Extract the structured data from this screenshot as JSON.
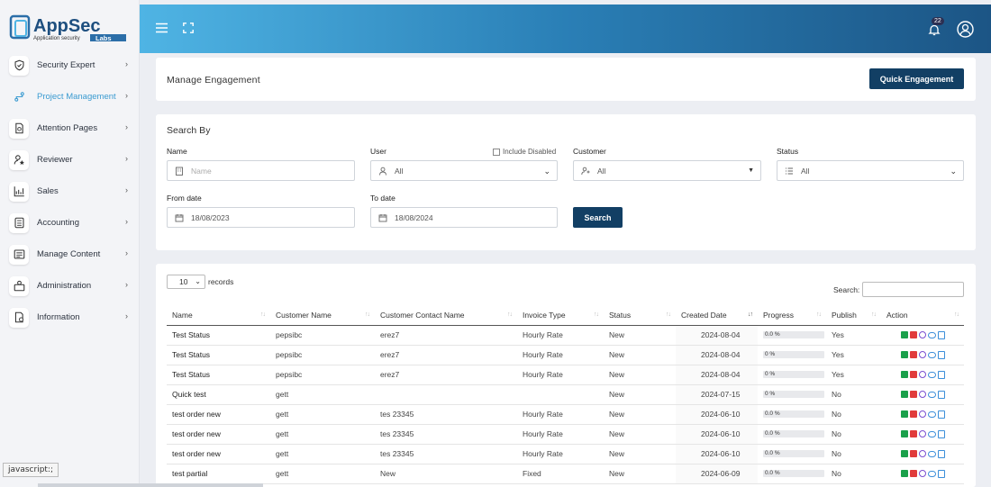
{
  "brand": {
    "name": "AppSec",
    "tagline": "Application security",
    "suffix": "Labs"
  },
  "sidebar": {
    "items": [
      {
        "label": "Security Expert",
        "icon": "shield-icon"
      },
      {
        "label": "Project Management",
        "icon": "project-icon"
      },
      {
        "label": "Attention Pages",
        "icon": "file-icon"
      },
      {
        "label": "Reviewer",
        "icon": "user-star-icon"
      },
      {
        "label": "Sales",
        "icon": "chart-icon"
      },
      {
        "label": "Accounting",
        "icon": "calculator-icon"
      },
      {
        "label": "Manage Content",
        "icon": "content-icon"
      },
      {
        "label": "Administration",
        "icon": "admin-icon"
      },
      {
        "label": "Information",
        "icon": "info-doc-icon"
      }
    ]
  },
  "header": {
    "notification_count": "22"
  },
  "manage": {
    "title": "Manage Engagement",
    "quick_button": "Quick Engagement"
  },
  "search": {
    "title": "Search By",
    "name_label": "Name",
    "name_placeholder": "Name",
    "user_label": "User",
    "user_value": "All",
    "include_disabled": "Include Disabled",
    "customer_label": "Customer",
    "customer_value": "All",
    "status_label": "Status",
    "status_value": "All",
    "from_label": "From date",
    "from_value": "18/08/2023",
    "to_label": "To date",
    "to_value": "18/08/2024",
    "button": "Search"
  },
  "table": {
    "page_size": "10",
    "records_label": "records",
    "search_label": "Search:",
    "columns": [
      "Name",
      "Customer Name",
      "Customer Contact Name",
      "Invoice Type",
      "Status",
      "Created Date",
      "Progress",
      "Publish",
      "Action"
    ],
    "rows": [
      {
        "name": "Test Status",
        "customer": "pepsibc",
        "contact": "erez7",
        "invoice": "Hourly Rate",
        "status": "New",
        "created": "2024-08-04",
        "progress": "0.0 %",
        "publish": "Yes"
      },
      {
        "name": "Test Status",
        "customer": "pepsibc",
        "contact": "erez7",
        "invoice": "Hourly Rate",
        "status": "New",
        "created": "2024-08-04",
        "progress": "0 %",
        "publish": "Yes"
      },
      {
        "name": "Test Status",
        "customer": "pepsibc",
        "contact": "erez7",
        "invoice": "Hourly Rate",
        "status": "New",
        "created": "2024-08-04",
        "progress": "0 %",
        "publish": "Yes"
      },
      {
        "name": "Quick test",
        "customer": "gett",
        "contact": "",
        "invoice": "",
        "status": "New",
        "created": "2024-07-15",
        "progress": "0 %",
        "publish": "No"
      },
      {
        "name": "test order new",
        "customer": "gett",
        "contact": "tes 23345",
        "invoice": "Hourly Rate",
        "status": "New",
        "created": "2024-06-10",
        "progress": "0.0 %",
        "publish": "No"
      },
      {
        "name": "test order new",
        "customer": "gett",
        "contact": "tes 23345",
        "invoice": "Hourly Rate",
        "status": "New",
        "created": "2024-06-10",
        "progress": "0.0 %",
        "publish": "No"
      },
      {
        "name": "test order new",
        "customer": "gett",
        "contact": "tes 23345",
        "invoice": "Hourly Rate",
        "status": "New",
        "created": "2024-06-10",
        "progress": "0.0 %",
        "publish": "No"
      },
      {
        "name": "test partial",
        "customer": "gett",
        "contact": "New",
        "invoice": "Fixed",
        "status": "New",
        "created": "2024-06-09",
        "progress": "0.0 %",
        "publish": "No"
      }
    ]
  },
  "status_bar": "javascript:;"
}
